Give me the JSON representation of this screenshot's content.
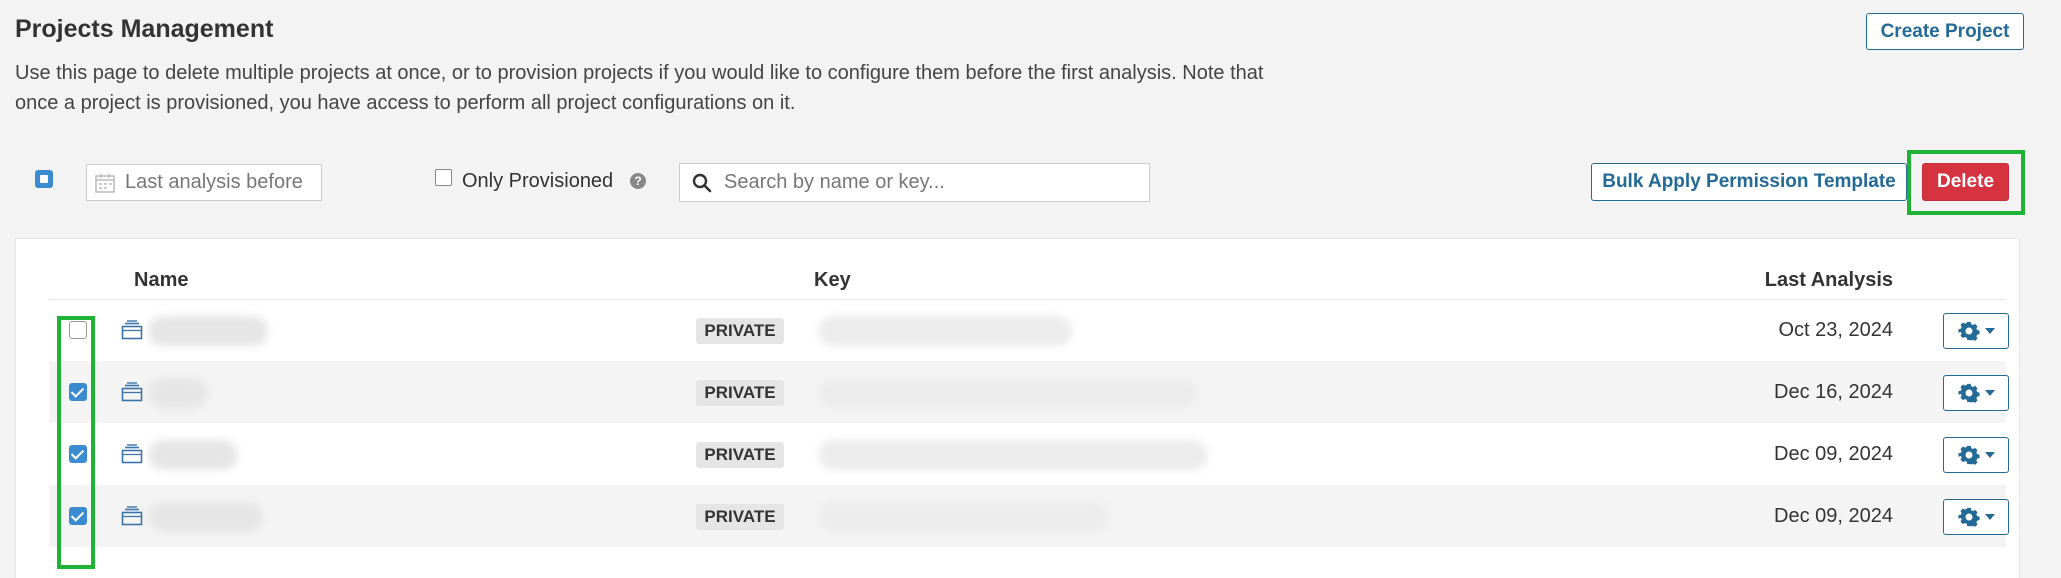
{
  "header": {
    "title": "Projects Management",
    "description": "Use this page to delete multiple projects at once, or to provision projects if you would like to configure them before the first analysis. Note that once a project is provisioned, you have access to perform all project configurations on it.",
    "create_label": "Create Project"
  },
  "toolbar": {
    "date_placeholder": "Last analysis before",
    "only_provisioned_label": "Only Provisioned",
    "help_glyph": "?",
    "search_placeholder": "Search by name or key...",
    "bulk_apply_label": "Bulk Apply Permission Template",
    "delete_label": "Delete"
  },
  "table": {
    "columns": {
      "name": "Name",
      "key": "Key",
      "last_analysis": "Last Analysis"
    },
    "rows": [
      {
        "selected": false,
        "visibility": "PRIVATE",
        "last_analysis": "Oct 23, 2024"
      },
      {
        "selected": true,
        "visibility": "PRIVATE",
        "last_analysis": "Dec 16, 2024"
      },
      {
        "selected": true,
        "visibility": "PRIVATE",
        "last_analysis": "Dec 09, 2024"
      },
      {
        "selected": true,
        "visibility": "PRIVATE",
        "last_analysis": "Dec 09, 2024"
      }
    ]
  },
  "colors": {
    "accent": "#236a97",
    "checkbox": "#3b8bd0",
    "danger": "#d4333f",
    "highlight": "#1fb336"
  }
}
